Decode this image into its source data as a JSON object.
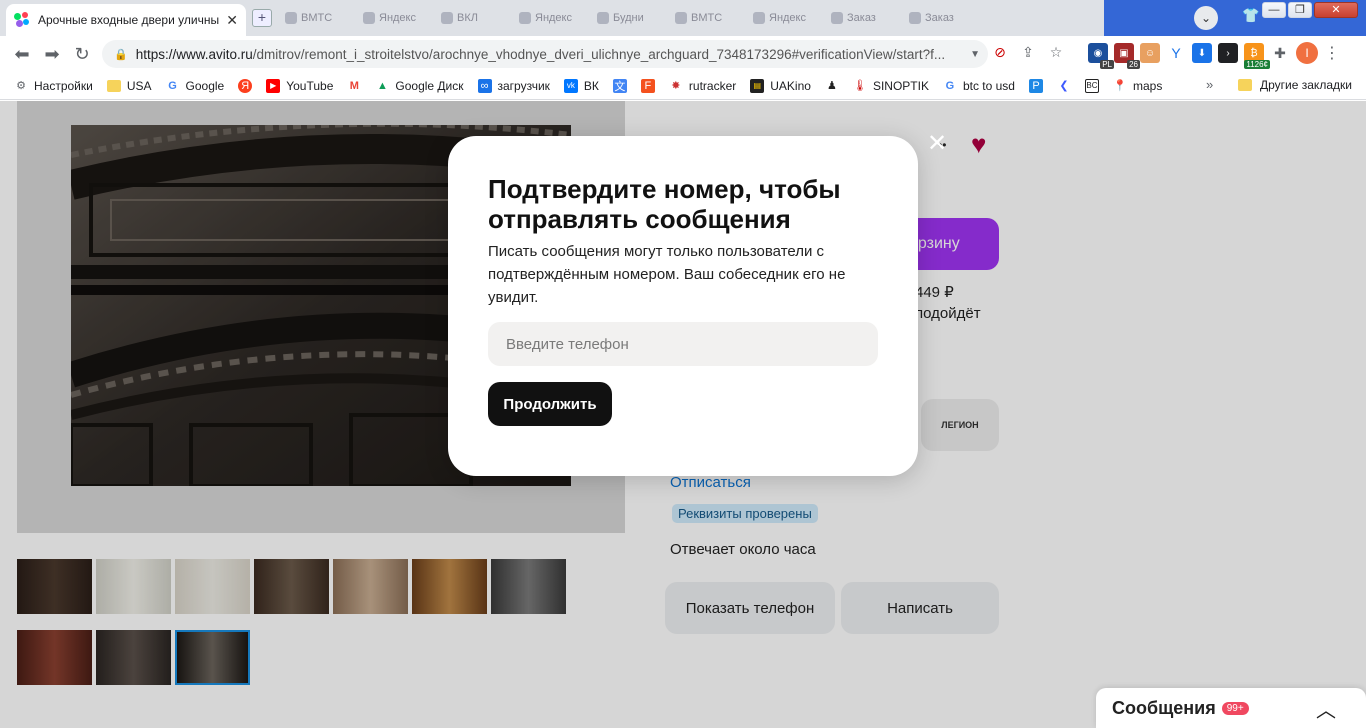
{
  "browser": {
    "active_tab": {
      "title": "Арочные входные двери уличны",
      "close": "✕"
    },
    "new_tab": "+",
    "other_tabs": [
      "ВМТС",
      "Яндекс",
      "ВКЛ",
      "Яндекс",
      "Будни",
      "ВМТС",
      "Яндекс",
      "Заказ",
      "Заказ"
    ],
    "url": {
      "host": "https://www.avito.ru",
      "path": "/dmitrov/remont_i_stroitelstvo/arochnye_vhodnye_dveri_ulichnye_archguard_7348173296#verificationView/start?f..."
    },
    "profile_avatar": "I",
    "ext_badges": {
      "pl": "PL",
      "count26": "26",
      "btc": "1126¢"
    },
    "window_controls": {
      "minimize": "—",
      "restore": "❐",
      "close": "✕"
    }
  },
  "bookmarks": {
    "items": [
      {
        "label": "Настройки",
        "icon": "gear-icon"
      },
      {
        "label": "USA",
        "icon": "folder-icon"
      },
      {
        "label": "Google",
        "icon": "google-icon"
      },
      {
        "label": "",
        "icon": "yandex-icon"
      },
      {
        "label": "YouTube",
        "icon": "youtube-icon"
      },
      {
        "label": "",
        "icon": "gmail-icon"
      },
      {
        "label": "Google Диск",
        "icon": "drive-icon"
      },
      {
        "label": "загрузчик",
        "icon": "loop-icon"
      },
      {
        "label": "ВК",
        "icon": "vk-icon"
      },
      {
        "label": "",
        "icon": "translate-icon"
      },
      {
        "label": "",
        "icon": "f-icon"
      },
      {
        "label": "rutracker",
        "icon": "rutracker-icon"
      },
      {
        "label": "UAKino",
        "icon": "uakino-icon"
      },
      {
        "label": "",
        "icon": "chess-icon"
      },
      {
        "label": "SINOPTIK",
        "icon": "thermometer-icon"
      },
      {
        "label": "btc to usd",
        "icon": "google-icon"
      },
      {
        "label": "",
        "icon": "p-icon"
      },
      {
        "label": "",
        "icon": "arrow-icon"
      },
      {
        "label": "",
        "icon": "bc-icon"
      },
      {
        "label": "maps",
        "icon": "maps-icon"
      }
    ],
    "more": "»",
    "other": "Другие закладки"
  },
  "listing": {
    "cart_button": "орзину",
    "price_fragment": "449 ₽",
    "fits_fragment": "подойдёт",
    "seller_logo": "ЛЕГИОН",
    "unsubscribe": "Отписаться",
    "verified_badge": "Реквизиты проверены",
    "responds": "Отвечает около часа",
    "show_phone_button": "Показать телефон",
    "write_button": "Написать"
  },
  "modal": {
    "title": "Подтвердите номер, чтобы отправлять сообщения",
    "description": "Писать сообщения могут только пользователи с подтверждённым номером. Ваш собеседник его не увидит.",
    "phone_placeholder": "Введите телефон",
    "phone_value": "",
    "continue_button": "Продолжить",
    "close": "✕"
  },
  "messages_widget": {
    "label": "Сообщения",
    "count": "99+",
    "chevron": "︿"
  },
  "colors": {
    "accent_purple": "#9f34f2",
    "heart": "#b00043",
    "link_blue": "#0a74d6",
    "badge_red": "#f04860",
    "modal_button": "#111111"
  }
}
